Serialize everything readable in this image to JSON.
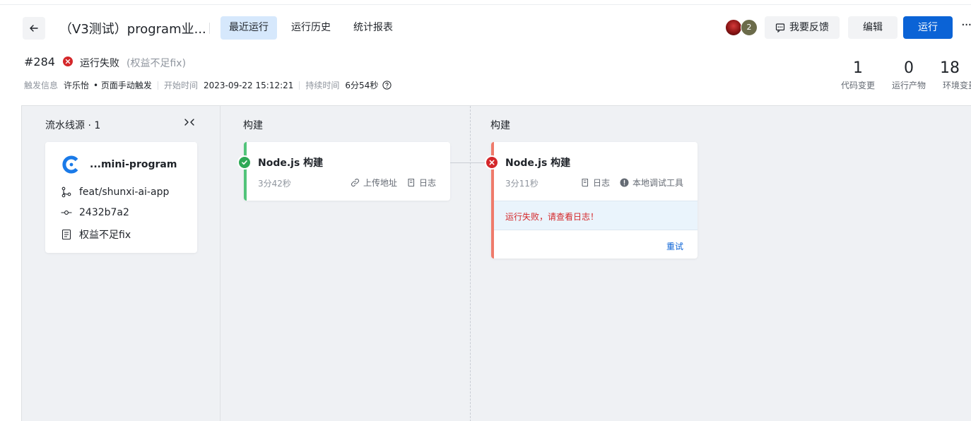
{
  "header": {
    "title": "（V3测试）program业...",
    "tabs": [
      {
        "label": "最近运行",
        "active": true
      },
      {
        "label": "运行历史",
        "active": false
      },
      {
        "label": "统计报表",
        "active": false
      }
    ],
    "avatar_count": "2",
    "feedback_label": "我要反馈",
    "edit_label": "编辑",
    "run_label": "运行",
    "more_label": "···"
  },
  "run": {
    "number": "#284",
    "status": "运行失败",
    "reason": "(权益不足fix)",
    "trigger_label": "触发信息",
    "trigger_user": "许乐怡",
    "trigger_type": "• 页面手动触发",
    "start_label": "开始时间",
    "start_time": "2023-09-22 15:12:21",
    "duration_label": "持续时间",
    "duration": "6分54秒"
  },
  "stats": [
    {
      "value": "1",
      "label": "代码变更"
    },
    {
      "value": "0",
      "label": "运行产物"
    },
    {
      "value": "18",
      "label": "环境变量"
    }
  ],
  "pipeline": {
    "source_column": {
      "title": "流水线源 · 1",
      "repo": "...mini-program",
      "branch": "feat/shunxi-ai-app",
      "commit": "2432b7a2",
      "message": "权益不足fix"
    },
    "stages": [
      {
        "title": "构建",
        "job": {
          "name": "Node.js 构建",
          "duration": "3分42秒",
          "status": "success",
          "actions": [
            "上传地址",
            "日志"
          ]
        }
      },
      {
        "title": "构建",
        "job": {
          "name": "Node.js 构建",
          "duration": "3分11秒",
          "status": "failed",
          "actions": [
            "日志",
            "本地调试工具"
          ],
          "error": "运行失败，请查看日志！",
          "retry_label": "重试"
        }
      }
    ]
  },
  "colors": {
    "primary": "#0b63d6",
    "success": "#2ea956",
    "danger": "#d4272a",
    "active_tab_bg": "#d6e8fc"
  }
}
